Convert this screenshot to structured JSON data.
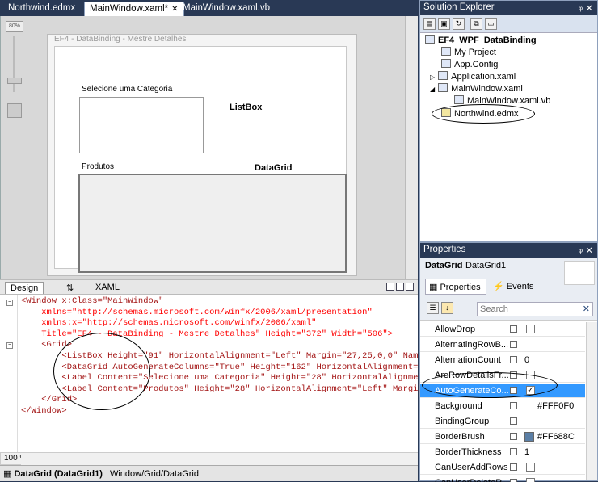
{
  "tabs": [
    {
      "label": "Northwind.edmx"
    },
    {
      "label": "MainWindow.xaml*"
    },
    {
      "label": "MainWindow.xaml.vb"
    }
  ],
  "designer": {
    "zoom_label": "80%",
    "window_title": "EF4 - DataBinding - Mestre Detalhes",
    "label_categoria": "Selecione uma Categoria",
    "label_produtos": "Produtos",
    "annotation_listbox": "ListBox",
    "annotation_datagrid": "DataGrid"
  },
  "split_tabs": {
    "design": "Design",
    "swap": "⇅",
    "xaml": "XAML"
  },
  "xaml_lines": [
    "<Window x:Class=\"MainWindow\"",
    "    xmlns=\"http://schemas.microsoft.com/winfx/2006/xaml/presentation\"",
    "    xmlns:x=\"http://schemas.microsoft.com/winfx/2006/xaml\"",
    "    Title=\"EF4 - DataBinding - Mestre Detalhes\" Height=\"372\" Width=\"506\">",
    "    <Grid>",
    "        <ListBox Height=\"91\" HorizontalAlignment=\"Left\" Margin=\"27,25,0,0\" Nam",
    "        <DataGrid AutoGenerateColumns=\"True\" Height=\"162\" HorizontalAlignment=",
    "        <Label Content=\"Selecione uma Categoria\" Height=\"28\" HorizontalAlignme",
    "        <Label Content=\"Produtos\" Height=\"28\" HorizontalAlignment=\"Left\" Margi",
    "    </Grid>",
    "</Window>"
  ],
  "editor_zoom": "100 %",
  "status": {
    "element": "DataGrid (DataGrid1)",
    "path": "Window/Grid/DataGrid"
  },
  "solution_explorer": {
    "title": "Solution Explorer",
    "project": "EF4_WPF_DataBinding",
    "items": [
      {
        "label": "My Project"
      },
      {
        "label": "App.Config"
      },
      {
        "label": "Application.xaml"
      },
      {
        "label": "MainWindow.xaml"
      },
      {
        "label": "MainWindow.xaml.vb"
      },
      {
        "label": "Northwind.edmx"
      }
    ]
  },
  "properties": {
    "title": "Properties",
    "type_name": "DataGrid",
    "instance_name": "DataGrid1",
    "tab_properties": "Properties",
    "tab_events": "Events",
    "search_placeholder": "Search",
    "rows": [
      {
        "name": "AllowDrop",
        "value": "",
        "checkbox": true,
        "checked": false
      },
      {
        "name": "AlternatingRowB...",
        "value": "",
        "checkbox": false,
        "checked": false
      },
      {
        "name": "AlternationCount",
        "value": "0",
        "checkbox": false,
        "checked": false
      },
      {
        "name": "AreRowDetailsFr...",
        "value": "",
        "checkbox": true,
        "checked": false
      },
      {
        "name": "AutoGenerateCo...",
        "value": "",
        "checkbox": true,
        "checked": true
      },
      {
        "name": "Background",
        "value": "#FFF0F0",
        "checkbox": false,
        "checked": false
      },
      {
        "name": "BindingGroup",
        "value": "",
        "checkbox": false,
        "checked": false
      },
      {
        "name": "BorderBrush",
        "value": "#FF688C",
        "checkbox": false,
        "checked": false
      },
      {
        "name": "BorderThickness",
        "value": "1",
        "checkbox": false,
        "checked": false
      },
      {
        "name": "CanUserAddRows",
        "value": "",
        "checkbox": true,
        "checked": false
      },
      {
        "name": "CanUserDeleteR...",
        "value": "",
        "checkbox": true,
        "checked": false
      }
    ]
  },
  "colors": {
    "selection": "#3399ff",
    "chrome": "#293955",
    "border_brush": "#5b7fa6"
  }
}
